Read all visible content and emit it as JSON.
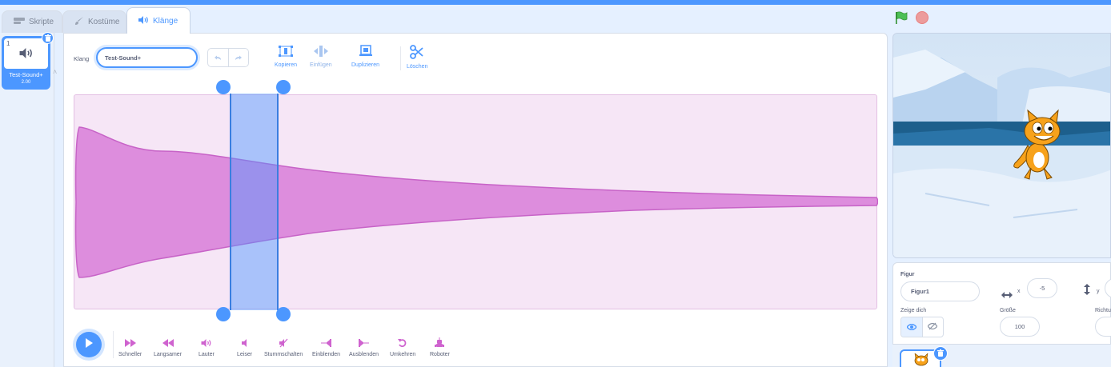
{
  "tabs": [
    {
      "label": "Skripte",
      "icon": "code-icon"
    },
    {
      "label": "Kostüme",
      "icon": "brush-icon"
    },
    {
      "label": "Klänge",
      "icon": "speaker-icon"
    }
  ],
  "active_tab": "Klänge",
  "sound_list": [
    {
      "index": "1",
      "name": "Test-Sound+",
      "duration": "2.00"
    }
  ],
  "editor": {
    "name_label": "Klang",
    "name_value": "Test-Sound+",
    "tools": [
      {
        "label": "Kopieren",
        "icon": "copy-icon",
        "enabled": true
      },
      {
        "label": "Einfügen",
        "icon": "paste-icon",
        "enabled": false
      },
      {
        "label": "Duplizieren",
        "icon": "duplicate-icon",
        "enabled": true
      },
      {
        "label": "Löschen",
        "icon": "scissors-icon",
        "enabled": true
      }
    ],
    "effects": [
      {
        "label": "Schneller",
        "icon": "faster-icon"
      },
      {
        "label": "Langsamer",
        "icon": "slower-icon"
      },
      {
        "label": "Lauter",
        "icon": "louder-icon"
      },
      {
        "label": "Leiser",
        "icon": "softer-icon"
      },
      {
        "label": "Stummschalten",
        "icon": "mute-icon"
      },
      {
        "label": "Einblenden",
        "icon": "fade-in-icon"
      },
      {
        "label": "Ausblenden",
        "icon": "fade-out-icon"
      },
      {
        "label": "Umkehren",
        "icon": "reverse-icon"
      },
      {
        "label": "Roboter",
        "icon": "robot-icon"
      }
    ],
    "selection": {
      "start_fraction": 0.195,
      "end_fraction": 0.255
    }
  },
  "sprite_info": {
    "sprite_label": "Figur",
    "sprite_name": "Figur1",
    "x_label": "x",
    "x_value": "-5",
    "y_label": "y",
    "show_label": "Zeige dich",
    "size_label": "Größe",
    "size_value": "100",
    "direction_label": "Richtu"
  },
  "colors": {
    "accent": "#4c97ff",
    "sound_magenta": "#cf63cf",
    "wave_fill": "#dd8ddd",
    "wave_bg": "#f6e6f6"
  }
}
